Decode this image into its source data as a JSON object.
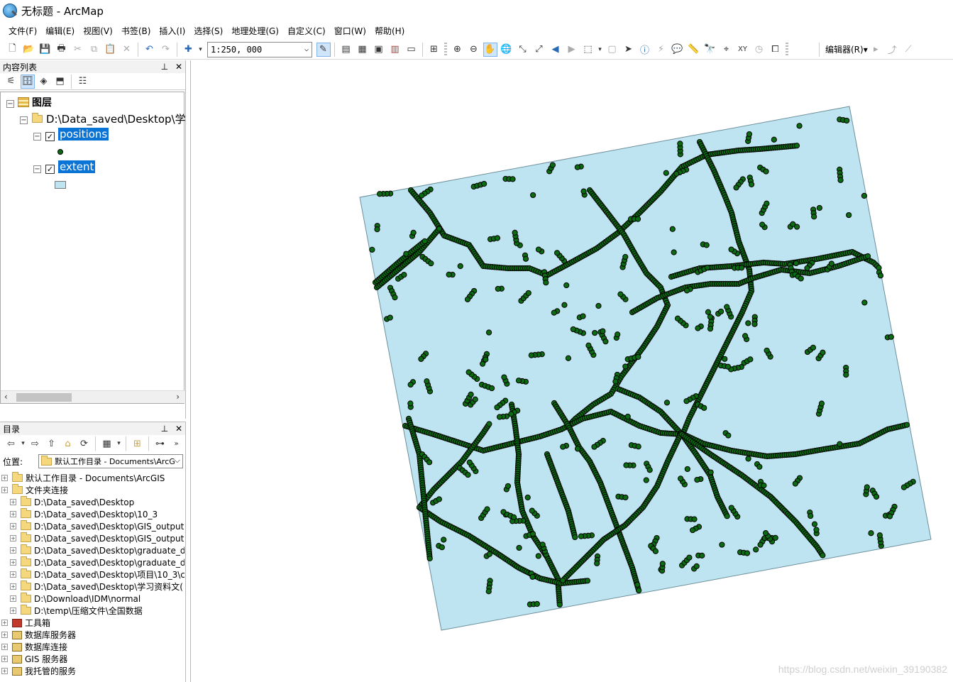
{
  "window": {
    "title": "无标题 - ArcMap"
  },
  "menu": [
    "文件(F)",
    "编辑(E)",
    "视图(V)",
    "书签(B)",
    "插入(I)",
    "选择(S)",
    "地理处理(G)",
    "自定义(C)",
    "窗口(W)",
    "帮助(H)"
  ],
  "toolbar": {
    "scale": "1:250, 000",
    "editor": "编辑器(R)▾"
  },
  "toc": {
    "title": "内容列表",
    "root_label": "图层",
    "folder_label": "D:\\Data_saved\\Desktop\\学",
    "layers": [
      {
        "name": "positions",
        "checked": true
      },
      {
        "name": "extent",
        "checked": true
      }
    ],
    "colors": {
      "positions_symbol": "#0b6b12",
      "extent_symbol": "#bfe4f1",
      "selection": "#0a73d6"
    }
  },
  "catalog": {
    "title": "目录",
    "location_label": "位置:",
    "location_value": "默认工作目录 - Documents\\ArcG",
    "items": [
      {
        "label": "默认工作目录 - Documents\\ArcGIS",
        "level": 0,
        "icon": "home-folder"
      },
      {
        "label": "文件夹连接",
        "level": 0,
        "icon": "folder"
      },
      {
        "label": "D:\\Data_saved\\Desktop",
        "level": 1,
        "icon": "folder"
      },
      {
        "label": "D:\\Data_saved\\Desktop\\10_3",
        "level": 1,
        "icon": "folder"
      },
      {
        "label": "D:\\Data_saved\\Desktop\\GIS_output",
        "level": 1,
        "icon": "folder"
      },
      {
        "label": "D:\\Data_saved\\Desktop\\GIS_output",
        "level": 1,
        "icon": "folder"
      },
      {
        "label": "D:\\Data_saved\\Desktop\\graduate_d",
        "level": 1,
        "icon": "folder"
      },
      {
        "label": "D:\\Data_saved\\Desktop\\graduate_d",
        "level": 1,
        "icon": "folder"
      },
      {
        "label": "D:\\Data_saved\\Desktop\\项目\\10_3\\c",
        "level": 1,
        "icon": "folder"
      },
      {
        "label": "D:\\Data_saved\\Desktop\\学习资料文(",
        "level": 1,
        "icon": "folder"
      },
      {
        "label": "D:\\Download\\IDM\\normal",
        "level": 1,
        "icon": "folder"
      },
      {
        "label": "D:\\temp\\压缩文件\\全国数据",
        "level": 1,
        "icon": "folder"
      },
      {
        "label": "工具箱",
        "level": 0,
        "icon": "toolbox"
      },
      {
        "label": "数据库服务器",
        "level": 0,
        "icon": "server"
      },
      {
        "label": "数据库连接",
        "level": 0,
        "icon": "server"
      },
      {
        "label": "GIS 服务器",
        "level": 0,
        "icon": "server"
      },
      {
        "label": "我托管的服务",
        "level": 0,
        "icon": "server"
      }
    ]
  },
  "map": {
    "extent_fill": "#bfe4f1",
    "point_fill": "#0b6b12"
  },
  "watermark": "https://blog.csdn.net/weixin_39190382"
}
